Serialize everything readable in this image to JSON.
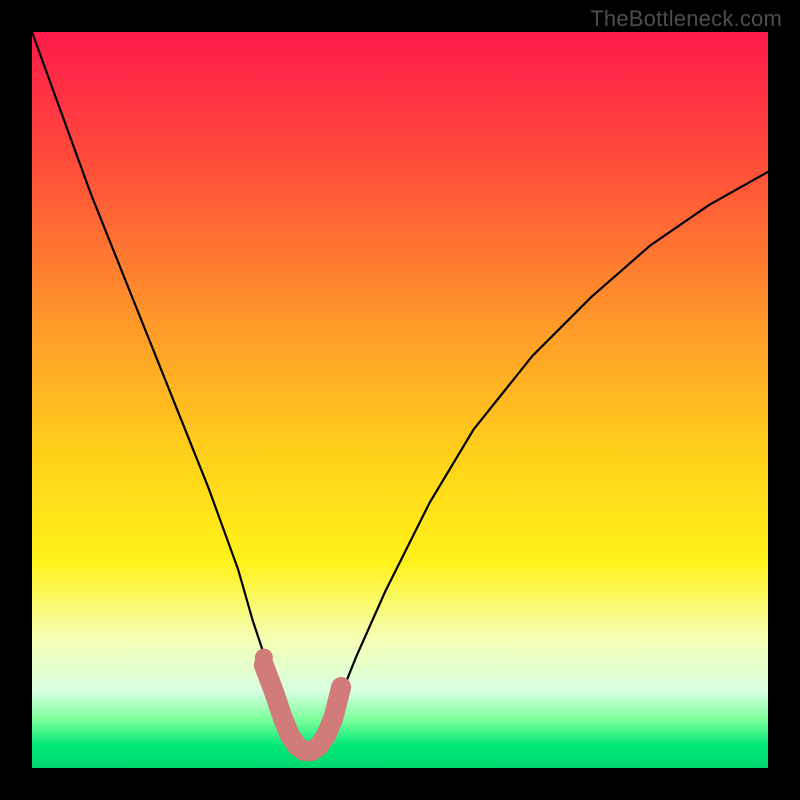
{
  "watermark": "TheBottleneck.com",
  "chart_data": {
    "type": "line",
    "title": "",
    "xlabel": "",
    "ylabel": "",
    "xlim": [
      0,
      100
    ],
    "ylim": [
      0,
      100
    ],
    "grid": false,
    "legend": false,
    "background_gradient": {
      "stops": [
        {
          "pos": 0.0,
          "color": "#ff1a4b"
        },
        {
          "pos": 0.18,
          "color": "#ff4d3a"
        },
        {
          "pos": 0.4,
          "color": "#ff9a2a"
        },
        {
          "pos": 0.58,
          "color": "#ffd21a"
        },
        {
          "pos": 0.72,
          "color": "#fff21a"
        },
        {
          "pos": 0.82,
          "color": "#f6ffb0"
        },
        {
          "pos": 0.895,
          "color": "#d8ffe0"
        },
        {
          "pos": 0.935,
          "color": "#7aff9a"
        },
        {
          "pos": 0.97,
          "color": "#00e878"
        },
        {
          "pos": 1.0,
          "color": "#00d870"
        }
      ]
    },
    "note": "Axes are unlabeled in source; x/y are placeholder 0–100 units. Curve values are read off by vertical pixel position (100 = top, 0 = bottom).",
    "series": [
      {
        "name": "main-curve",
        "color": "#000000",
        "x": [
          0,
          4,
          8,
          12,
          16,
          20,
          24,
          28,
          30,
          32,
          33,
          34,
          35,
          36,
          37,
          38,
          39,
          40,
          41,
          42,
          44,
          48,
          54,
          60,
          68,
          76,
          84,
          92,
          100
        ],
        "y": [
          100,
          89,
          78,
          68,
          58,
          48,
          38,
          27,
          20,
          14,
          10,
          7,
          4.5,
          3,
          2.3,
          2.3,
          3,
          4.5,
          7,
          10,
          15,
          24,
          36,
          46,
          56,
          64,
          71,
          76.5,
          81
        ]
      },
      {
        "name": "highlight-band",
        "color": "#d17b7b",
        "x": [
          31.5,
          33,
          34,
          35,
          36,
          37,
          38,
          39,
          40,
          41,
          42
        ],
        "y": [
          14,
          10,
          7,
          4.5,
          3,
          2.3,
          2.3,
          3,
          4.5,
          7,
          11
        ]
      }
    ],
    "markers": [
      {
        "name": "dot-left",
        "x": 31.5,
        "y": 15,
        "color": "#d17b7b"
      }
    ]
  }
}
